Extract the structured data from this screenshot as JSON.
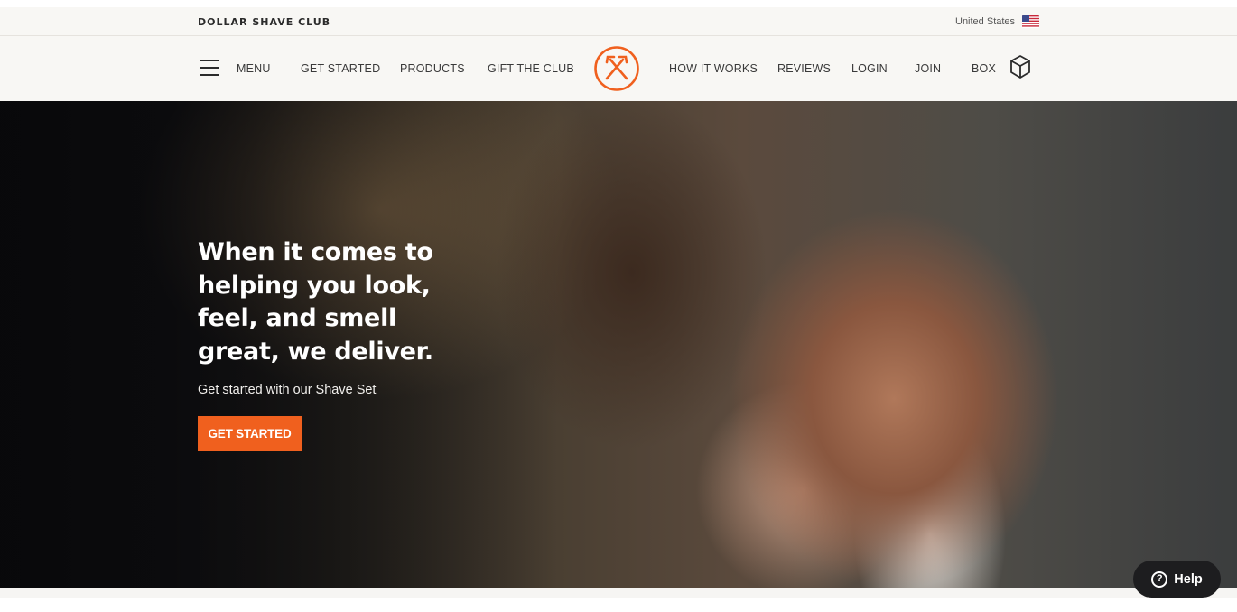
{
  "utility": {
    "brand": "DOLLAR SHAVE CLUB",
    "country": "United States",
    "flag_icon": "us-flag-icon"
  },
  "nav": {
    "menu_label": "MENU",
    "left_items": [
      {
        "label": "GET STARTED"
      },
      {
        "label": "PRODUCTS"
      },
      {
        "label": "GIFT THE CLUB"
      }
    ],
    "right_items": [
      {
        "label": "HOW IT WORKS"
      },
      {
        "label": "REVIEWS"
      },
      {
        "label": "LOGIN"
      },
      {
        "label": "JOIN"
      },
      {
        "label": "BOX"
      }
    ],
    "logo_icon": "crossed-razors-logo-icon",
    "box_icon": "box-icon"
  },
  "hero": {
    "title": "When it comes to helping you look, feel, and smell great, we deliver.",
    "subtitle": "Get started with our Shave Set",
    "cta_label": "GET STARTED"
  },
  "help": {
    "label": "Help",
    "icon": "question-circle-icon"
  },
  "colors": {
    "accent": "#f0601e",
    "nav_bg": "#f8f7f4",
    "help_bg": "#1d1d1f"
  }
}
